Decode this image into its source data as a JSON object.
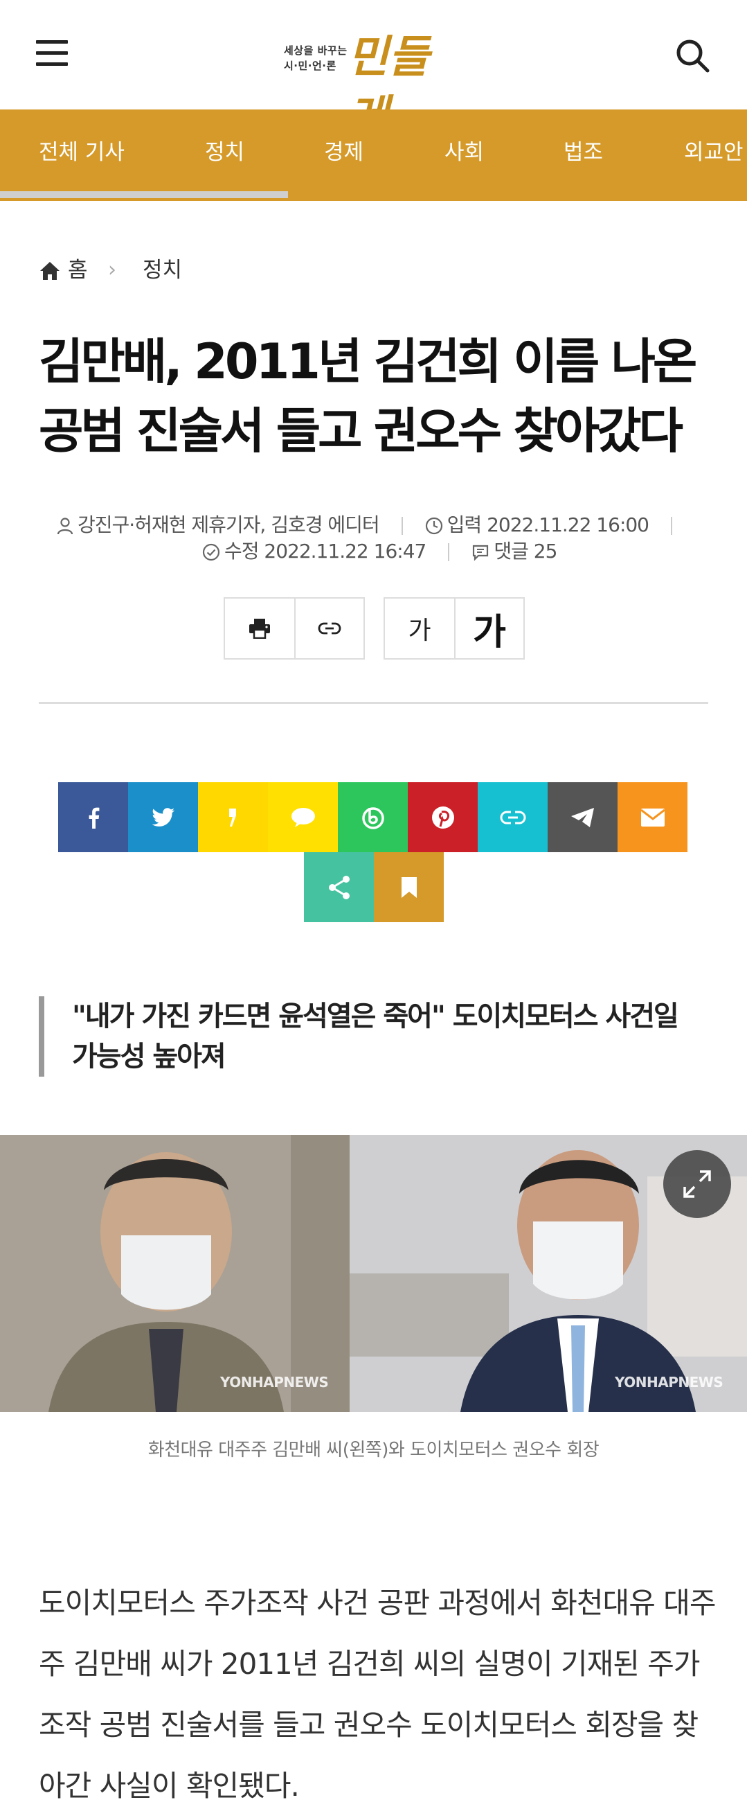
{
  "header": {
    "logo_small": "세상을 바꾸는\n시·민·언·론",
    "logo_big": "민들레",
    "accent": "#d59a2a"
  },
  "nav": {
    "items": [
      {
        "label": "전체 기사"
      },
      {
        "label": "정치"
      },
      {
        "label": "경제"
      },
      {
        "label": "사회"
      },
      {
        "label": "법조"
      },
      {
        "label": "외교안"
      }
    ]
  },
  "breadcrumb": {
    "home": "홈",
    "separator": "›",
    "category": "정치"
  },
  "article": {
    "title": "김만배, 2011년 김건희 이름 나온 공범 진술서 들고 권오수 찾아갔다",
    "author": "강진구·허재현 제휴기자, 김호경 에디터",
    "published": "입력 2022.11.22 16:00",
    "modified": "수정 2022.11.22 16:47",
    "comments": "댓글 25",
    "subtitle": "\"내가 가진 카드면 윤석열은 죽어\" 도이치모터스 사건일 가능성 높아져",
    "caption": "화천대유 대주주 김만배 씨(왼쪽)와 도이치모터스 권오수 회장",
    "watermark": "YONHAPNEWS",
    "body": "도이치모터스 주가조작 사건 공판 과정에서 화천대유 대주주 김만배 씨가 2011년 김건희 씨의 실명이 기재된 주가조작 공범 진술서를 들고 권오수 도이치모터스 회장을 찾아간 사실이 확인됐다."
  },
  "tools": {
    "font_small": "가",
    "font_large": "가"
  },
  "share": [
    {
      "icon": "facebook-icon",
      "color": "#3b5998"
    },
    {
      "icon": "twitter-icon",
      "color": "#1a8fc9"
    },
    {
      "icon": "kakaostory-icon",
      "color": "#ffd800"
    },
    {
      "icon": "kakaotalk-icon",
      "color": "#ffe000"
    },
    {
      "icon": "band-icon",
      "color": "#2dc65c"
    },
    {
      "icon": "pinterest-icon",
      "color": "#cb2027"
    },
    {
      "icon": "link-icon",
      "color": "#16c0d1"
    },
    {
      "icon": "telegram-icon",
      "color": "#555555"
    },
    {
      "icon": "email-icon",
      "color": "#f7941d"
    },
    {
      "icon": "share-icon",
      "color": "#45c3a0"
    },
    {
      "icon": "bookmark-icon",
      "color": "#d59a2a"
    }
  ]
}
